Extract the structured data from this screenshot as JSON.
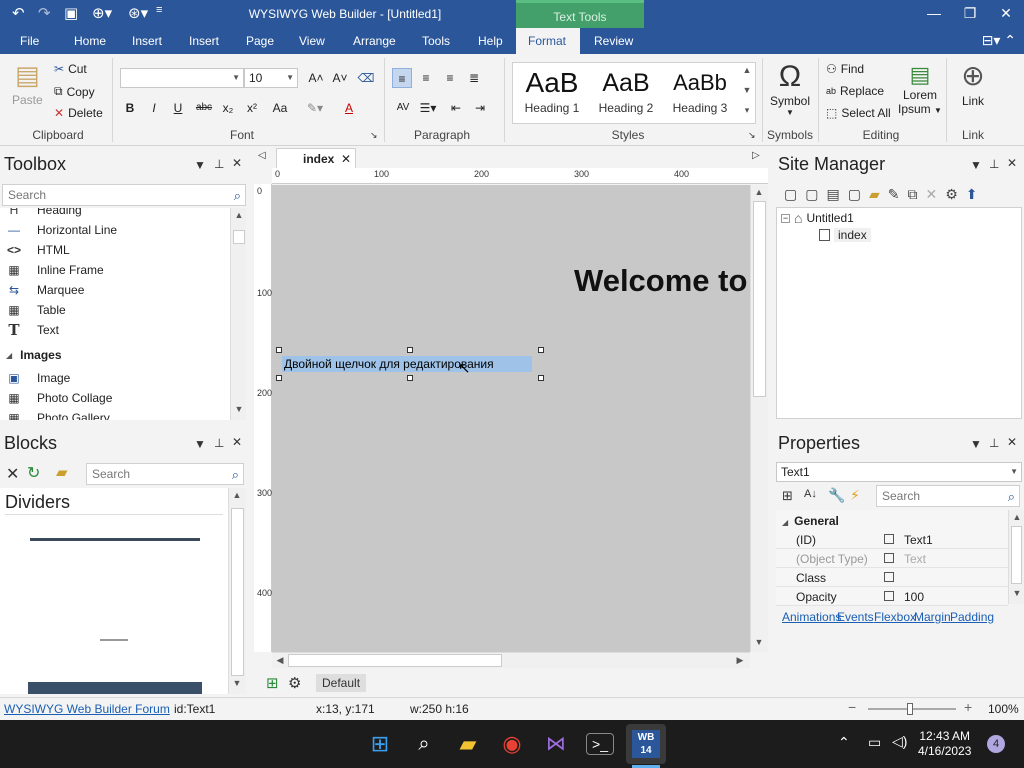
{
  "app": {
    "title": "WYSIWYG Web Builder - [Untitled1]",
    "context_tab_group": "Text Tools"
  },
  "menu": [
    "File",
    "Home",
    "Insert",
    "Insert",
    "Page",
    "View",
    "Arrange",
    "Tools",
    "Help",
    "Format",
    "Review"
  ],
  "ribbon": {
    "clipboard": {
      "paste": "Paste",
      "cut": "Cut",
      "copy": "Copy",
      "delete": "Delete",
      "label": "Clipboard"
    },
    "font": {
      "font_name": "",
      "font_size": "10",
      "label": "Font",
      "bold": "B",
      "italic": "I",
      "underline": "U",
      "strike": "abc",
      "sub": "x₂",
      "sup": "x²",
      "case": "Aa",
      "color": "A"
    },
    "paragraph": {
      "label": "Paragraph"
    },
    "styles": {
      "label": "Styles",
      "items": [
        {
          "sample": "AaB",
          "name": "Heading 1"
        },
        {
          "sample": "AaB",
          "name": "Heading 2"
        },
        {
          "sample": "AaBb",
          "name": "Heading 3"
        }
      ]
    },
    "symbols": {
      "symbol": "Symbol",
      "label": "Symbols",
      "glyph": "Ω"
    },
    "editing": {
      "find": "Find",
      "replace": "Replace",
      "select_all": "Select All",
      "lorem": "Lorem",
      "ipsum": "Ipsum",
      "label": "Editing"
    },
    "link": {
      "link": "Link",
      "label": "Link"
    }
  },
  "toolbox": {
    "title": "Toolbox",
    "search_placeholder": "Search",
    "items": [
      "Heading",
      "Horizontal Line",
      "HTML",
      "Inline Frame",
      "Marquee",
      "Table",
      "Text"
    ],
    "section": "Images",
    "image_items": [
      "Image",
      "Photo Collage",
      "Photo Gallery"
    ]
  },
  "blocks": {
    "title": "Blocks",
    "search_placeholder": "Search",
    "category": "Dividers"
  },
  "document": {
    "tab": "index",
    "ruler_h": [
      "0",
      "100",
      "200",
      "300",
      "400"
    ],
    "ruler_v": [
      "0",
      "100",
      "200",
      "300",
      "400"
    ],
    "welcome_text": "Welcome to",
    "text1": "Двойной щелчок для редактирования",
    "default_btn": "Default"
  },
  "site_manager": {
    "title": "Site Manager",
    "root": "Untitled1",
    "page": "index"
  },
  "properties": {
    "title": "Properties",
    "selected": "Text1",
    "search_placeholder": "Search",
    "section": "General",
    "rows": [
      {
        "key": "(ID)",
        "value": "Text1",
        "disabled": false
      },
      {
        "key": "(Object Type)",
        "value": "Text",
        "disabled": true
      },
      {
        "key": "Class",
        "value": "",
        "disabled": false
      },
      {
        "key": "Opacity",
        "value": "100",
        "disabled": false
      }
    ],
    "links": [
      "Animations",
      "Events",
      "Flexbox",
      "Margin",
      "Padding"
    ]
  },
  "status": {
    "forum": "WYSIWYG Web Builder Forum",
    "id": "id:Text1",
    "pos": "x:13, y:171",
    "size": "w:250 h:16",
    "zoom": "100%"
  },
  "taskbar": {
    "time": "12:43 AM",
    "date": "4/16/2023",
    "badge": "4",
    "wb_label": "WB 14"
  },
  "colors": {
    "accent": "#2b579a",
    "text_tools": "#43a06b",
    "selection": "#9fc3e8"
  }
}
